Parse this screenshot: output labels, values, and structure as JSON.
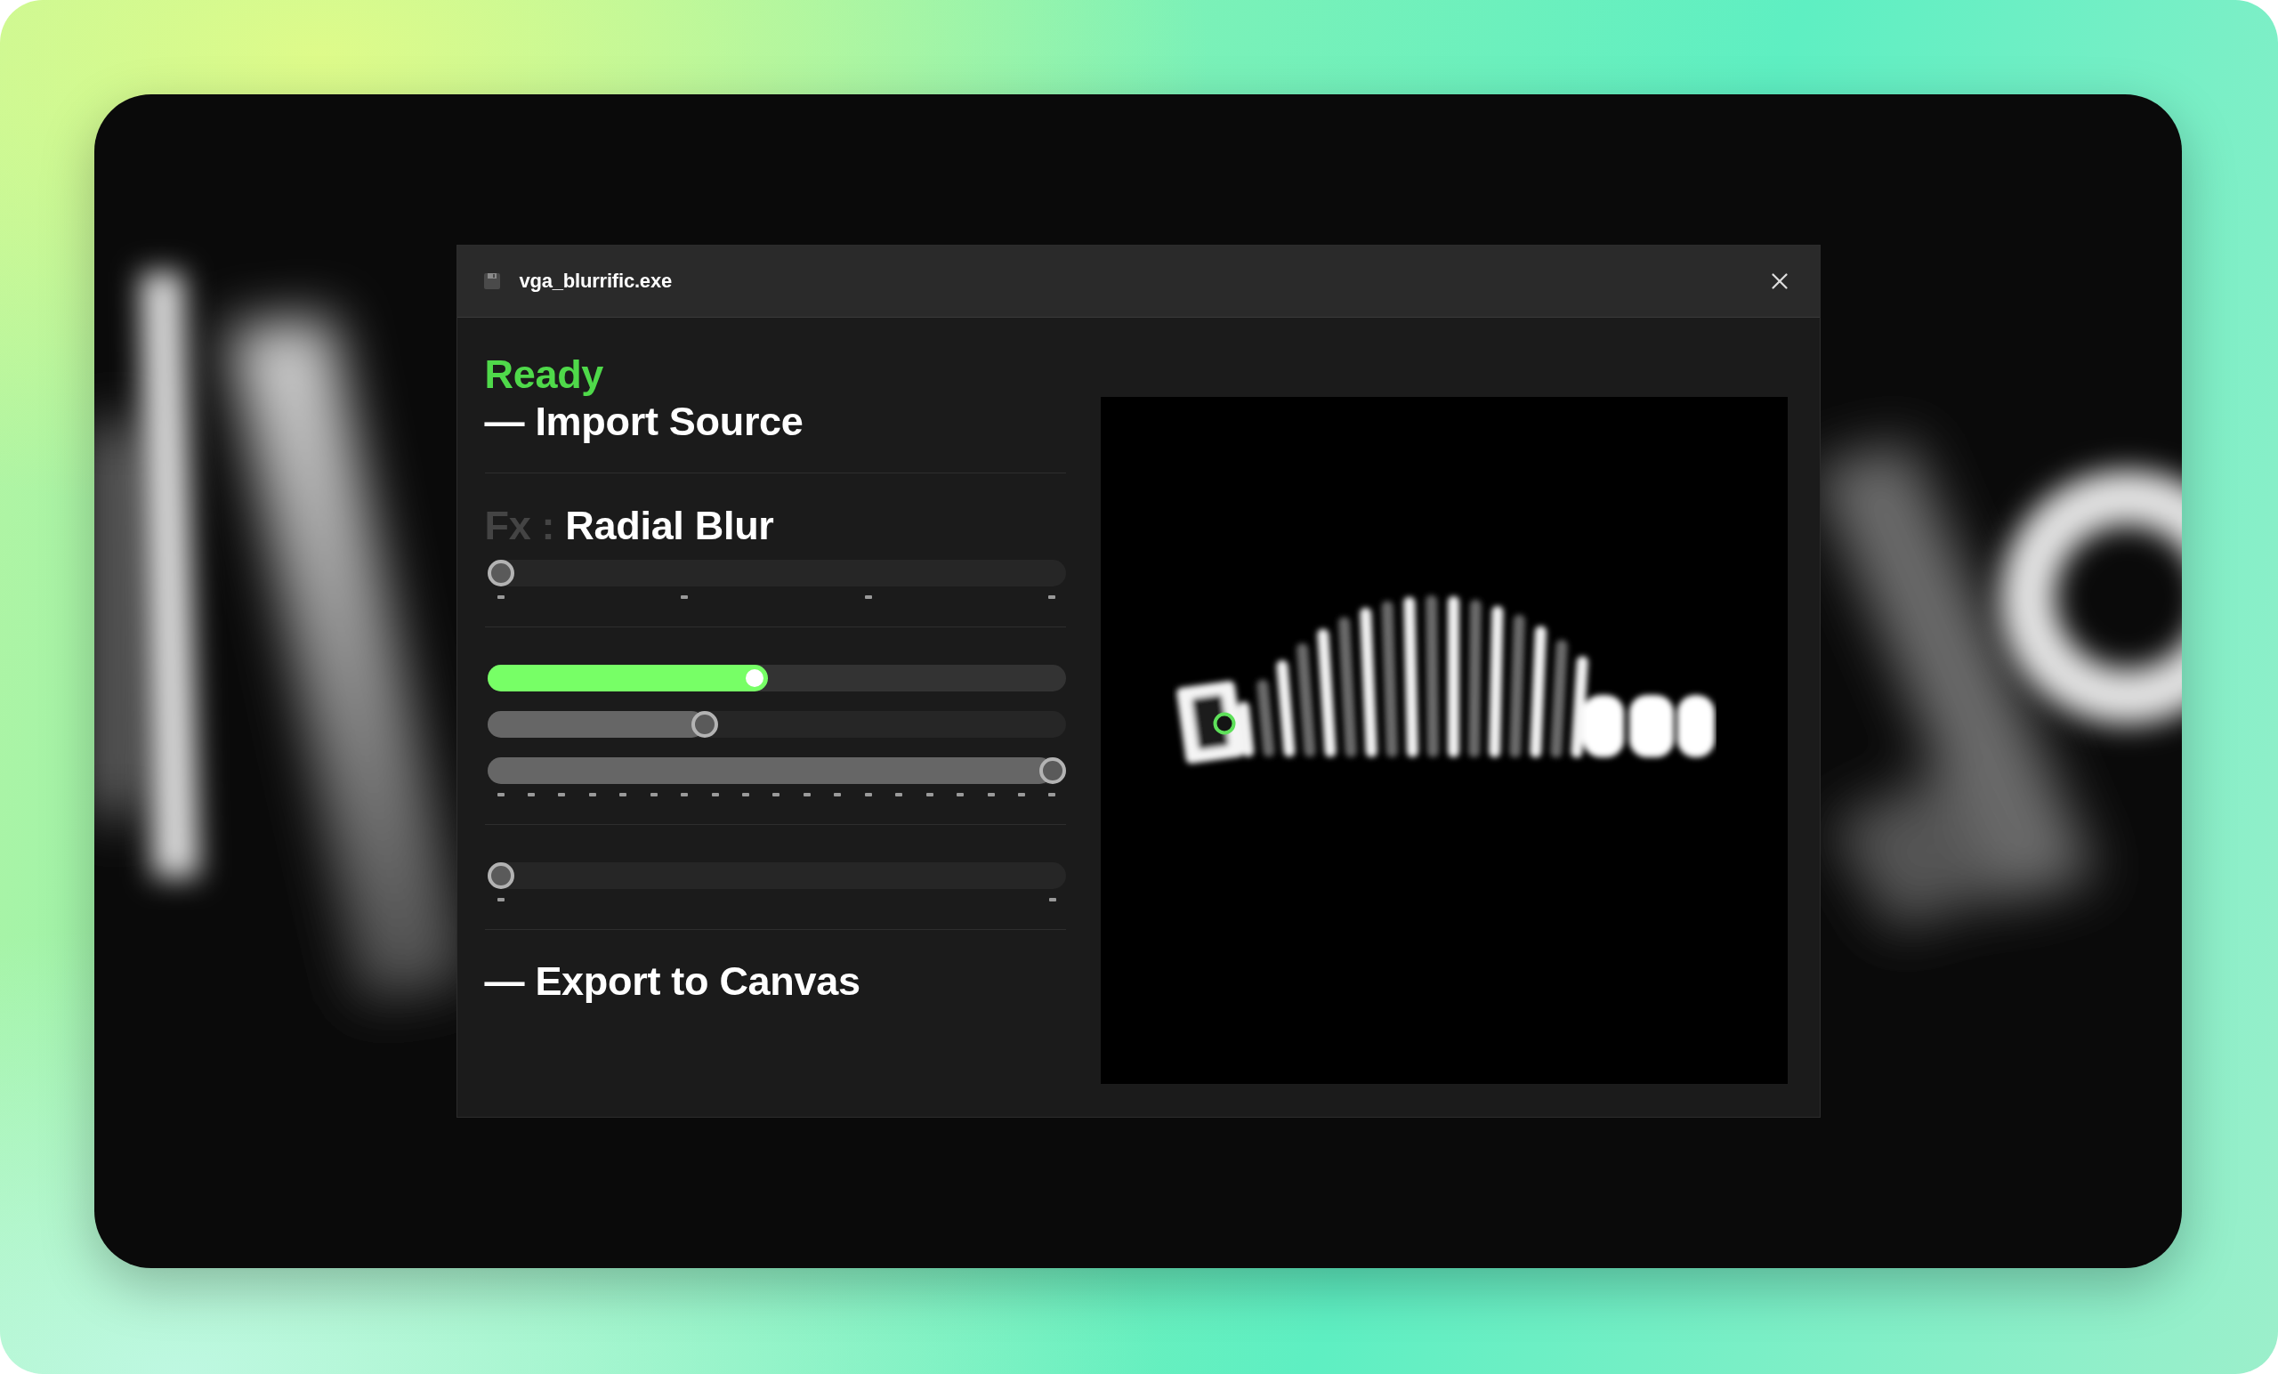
{
  "window": {
    "title": "vga_blurrific.exe"
  },
  "status": "Ready",
  "import_label": "— Import Source",
  "effect": {
    "prefix": "Fx :",
    "name": "Radial Blur"
  },
  "slider_groups": [
    {
      "kind": "quarters",
      "sliders": [
        {
          "kind": "plain",
          "level": 0
        }
      ]
    },
    {
      "kind": "steps",
      "sliders": [
        {
          "kind": "accent",
          "level": 0.46
        },
        {
          "kind": "plain",
          "level": 0.37
        },
        {
          "kind": "plain",
          "level": 1
        }
      ]
    },
    {
      "kind": "ends",
      "sliders": [
        {
          "kind": "plain",
          "level": 0
        }
      ]
    }
  ],
  "export_label": "— Export to Canvas"
}
